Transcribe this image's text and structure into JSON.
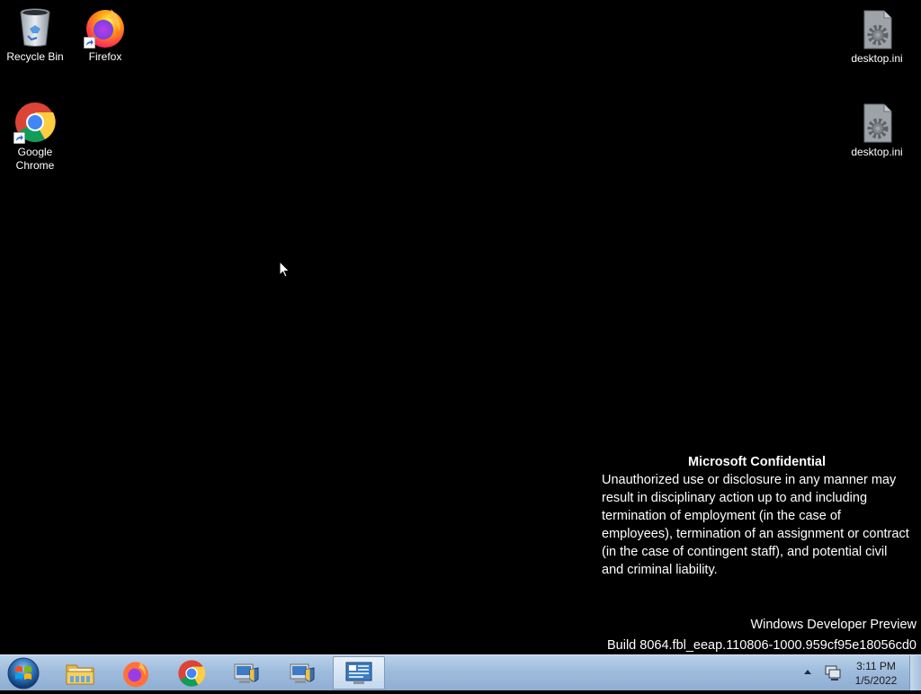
{
  "desktop": {
    "icons": [
      {
        "label": "Recycle Bin",
        "icon": "recycle-bin-icon"
      },
      {
        "label": "Firefox",
        "icon": "firefox-icon"
      },
      {
        "label": "Google Chrome",
        "icon": "chrome-icon"
      },
      {
        "label": "desktop.ini",
        "icon": "settings-file-icon"
      },
      {
        "label": "desktop.ini",
        "icon": "settings-file-icon"
      }
    ],
    "notice": {
      "title": "Microsoft Confidential",
      "body": "Unauthorized use or disclosure in any manner may result in disciplinary action up to and including termination of employment (in the case of employees), termination of an assignment or contract (in the case of contingent staff), and potential civil and criminal liability."
    },
    "watermark": {
      "product": "Windows Developer Preview",
      "build": "Build 8064.fbl_eeap.110806-1000.959cf95e18056cd0"
    }
  },
  "taskbar": {
    "start_icon": "windows-start-icon",
    "pinned": [
      {
        "name": "File Explorer",
        "icon": "folder-icon"
      },
      {
        "name": "Firefox",
        "icon": "firefox-icon"
      },
      {
        "name": "Google Chrome",
        "icon": "chrome-icon"
      },
      {
        "name": "Admin Tool 1",
        "icon": "admin-tool-icon"
      },
      {
        "name": "Admin Tool 2",
        "icon": "admin-tool-icon"
      },
      {
        "name": "Control Panel",
        "icon": "control-panel-icon"
      }
    ],
    "clock": {
      "time": "3:11 PM",
      "date": "1/5/2022"
    }
  },
  "colors": {
    "desktop_bg": "#000000",
    "taskbar_top": "#b9d1ea",
    "taskbar_bottom": "#8eaed3"
  }
}
